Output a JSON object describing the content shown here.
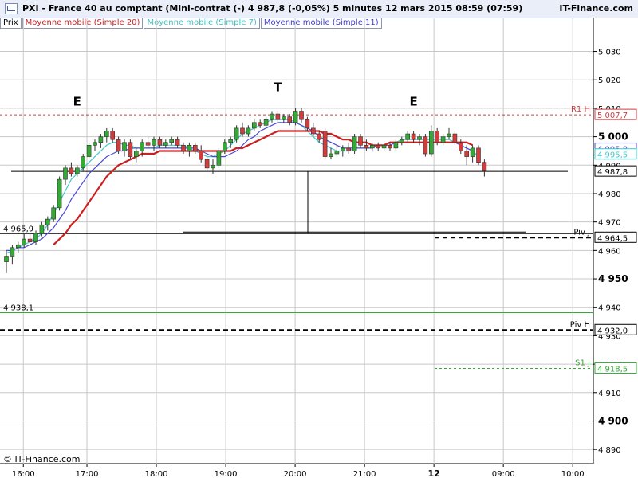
{
  "header": {
    "title": "PXI - France 40 au comptant (Mini-contrat  (-)    4 987,8 (-0,05%)    5 minutes  12 mars 2015 08:59 (07:59)",
    "brand": "IT-Finance.com"
  },
  "legend": {
    "prix": "Prix",
    "ma20": "Moyenne mobile (Simple 20)",
    "ma7": "Moyenne mobile (Simple 7)",
    "ma11": "Moyenne mobile (Simple 11)"
  },
  "copyright": "© IT-Finance.com",
  "colors": {
    "up": "#33aa33",
    "down": "#d23c3c",
    "ma20": "#cc2020",
    "ma7": "#40c8c8",
    "ma11": "#4a4ad8",
    "r1": "#d23c3c",
    "s1": "#33aa33",
    "grid": "#c8c8c8"
  },
  "chart_data": {
    "type": "candlestick",
    "ylim": [
      4885,
      5038
    ],
    "x_ticks": [
      "16:00",
      "17:00",
      "18:00",
      "19:00",
      "20:00",
      "21:00",
      "12",
      "09:00",
      "10:00"
    ],
    "y_ticks": [
      4890,
      4900,
      4910,
      4920,
      4930,
      4940,
      4950,
      4960,
      4970,
      4980,
      4990,
      5000,
      5010,
      5020,
      5030
    ],
    "y_tick_labels": [
      "4 890",
      "4 900",
      "4 910",
      "4 920",
      "4 930",
      "4 940",
      "4 950",
      "4 960",
      "4 970",
      "4 980",
      "4 990",
      "5 000",
      "5 010",
      "5 020",
      "5 030"
    ],
    "bold_ticks": [
      4900,
      4950,
      5000
    ],
    "candles": [
      {
        "o": 4956,
        "h": 4960,
        "l": 4952,
        "c": 4958
      },
      {
        "o": 4958,
        "h": 4962,
        "l": 4955,
        "c": 4961
      },
      {
        "o": 4961,
        "h": 4963,
        "l": 4959,
        "c": 4962
      },
      {
        "o": 4962,
        "h": 4966,
        "l": 4961,
        "c": 4964
      },
      {
        "o": 4964,
        "h": 4966,
        "l": 4962,
        "c": 4963
      },
      {
        "o": 4963,
        "h": 4967,
        "l": 4962,
        "c": 4966
      },
      {
        "o": 4966,
        "h": 4970,
        "l": 4965,
        "c": 4969
      },
      {
        "o": 4969,
        "h": 4972,
        "l": 4967,
        "c": 4971
      },
      {
        "o": 4971,
        "h": 4976,
        "l": 4970,
        "c": 4975
      },
      {
        "o": 4975,
        "h": 4986,
        "l": 4974,
        "c": 4985
      },
      {
        "o": 4985,
        "h": 4990,
        "l": 4983,
        "c": 4989
      },
      {
        "o": 4989,
        "h": 4991,
        "l": 4986,
        "c": 4987
      },
      {
        "o": 4987,
        "h": 4990,
        "l": 4986,
        "c": 4989
      },
      {
        "o": 4989,
        "h": 4994,
        "l": 4988,
        "c": 4993
      },
      {
        "o": 4993,
        "h": 4998,
        "l": 4992,
        "c": 4997
      },
      {
        "o": 4997,
        "h": 4999,
        "l": 4995,
        "c": 4998
      },
      {
        "o": 4998,
        "h": 5001,
        "l": 4996,
        "c": 5000
      },
      {
        "o": 5000,
        "h": 5003,
        "l": 4998,
        "c": 5002
      },
      {
        "o": 5002,
        "h": 5003,
        "l": 4998,
        "c": 4999
      },
      {
        "o": 4999,
        "h": 5000,
        "l": 4994,
        "c": 4995
      },
      {
        "o": 4995,
        "h": 4999,
        "l": 4993,
        "c": 4998
      },
      {
        "o": 4998,
        "h": 4999,
        "l": 4992,
        "c": 4993
      },
      {
        "o": 4993,
        "h": 4996,
        "l": 4991,
        "c": 4995
      },
      {
        "o": 4995,
        "h": 4999,
        "l": 4993,
        "c": 4998
      },
      {
        "o": 4998,
        "h": 5000,
        "l": 4996,
        "c": 4997
      },
      {
        "o": 4997,
        "h": 5000,
        "l": 4995,
        "c": 4999
      },
      {
        "o": 4999,
        "h": 5000,
        "l": 4996,
        "c": 4997
      },
      {
        "o": 4997,
        "h": 4999,
        "l": 4996,
        "c": 4998
      },
      {
        "o": 4998,
        "h": 5000,
        "l": 4997,
        "c": 4999
      },
      {
        "o": 4999,
        "h": 5000,
        "l": 4996,
        "c": 4997
      },
      {
        "o": 4997,
        "h": 4998,
        "l": 4994,
        "c": 4995
      },
      {
        "o": 4995,
        "h": 4998,
        "l": 4993,
        "c": 4997
      },
      {
        "o": 4997,
        "h": 4998,
        "l": 4994,
        "c": 4995
      },
      {
        "o": 4995,
        "h": 4997,
        "l": 4991,
        "c": 4992
      },
      {
        "o": 4992,
        "h": 4993,
        "l": 4988,
        "c": 4989
      },
      {
        "o": 4989,
        "h": 4992,
        "l": 4987,
        "c": 4990
      },
      {
        "o": 4990,
        "h": 4996,
        "l": 4989,
        "c": 4995
      },
      {
        "o": 4995,
        "h": 4999,
        "l": 4994,
        "c": 4998
      },
      {
        "o": 4998,
        "h": 5000,
        "l": 4996,
        "c": 4999
      },
      {
        "o": 4999,
        "h": 5004,
        "l": 4998,
        "c": 5003
      },
      {
        "o": 5003,
        "h": 5005,
        "l": 5000,
        "c": 5001
      },
      {
        "o": 5001,
        "h": 5004,
        "l": 5000,
        "c": 5003
      },
      {
        "o": 5003,
        "h": 5006,
        "l": 5002,
        "c": 5005
      },
      {
        "o": 5005,
        "h": 5006,
        "l": 5003,
        "c": 5004
      },
      {
        "o": 5004,
        "h": 5007,
        "l": 5003,
        "c": 5006
      },
      {
        "o": 5006,
        "h": 5009,
        "l": 5005,
        "c": 5008
      },
      {
        "o": 5008,
        "h": 5009,
        "l": 5005,
        "c": 5006
      },
      {
        "o": 5006,
        "h": 5008,
        "l": 5005,
        "c": 5007
      },
      {
        "o": 5007,
        "h": 5008,
        "l": 5004,
        "c": 5005
      },
      {
        "o": 5005,
        "h": 5010,
        "l": 5004,
        "c": 5009
      },
      {
        "o": 5009,
        "h": 5010,
        "l": 5005,
        "c": 5006
      },
      {
        "o": 5006,
        "h": 5007,
        "l": 5002,
        "c": 5003
      },
      {
        "o": 5003,
        "h": 5005,
        "l": 5000,
        "c": 5001
      },
      {
        "o": 5001,
        "h": 5002,
        "l": 4998,
        "c": 4999
      },
      {
        "o": 5002,
        "h": 5003,
        "l": 4992,
        "c": 4993
      },
      {
        "o": 4993,
        "h": 4996,
        "l": 4992,
        "c": 4994
      },
      {
        "o": 4994,
        "h": 4997,
        "l": 4993,
        "c": 4995
      },
      {
        "o": 4995,
        "h": 4997,
        "l": 4993,
        "c": 4996
      },
      {
        "o": 4996,
        "h": 4998,
        "l": 4994,
        "c": 4995
      },
      {
        "o": 4995,
        "h": 5001,
        "l": 4994,
        "c": 5000
      },
      {
        "o": 5000,
        "h": 5001,
        "l": 4996,
        "c": 4997
      },
      {
        "o": 4997,
        "h": 4999,
        "l": 4995,
        "c": 4996
      },
      {
        "o": 4996,
        "h": 4998,
        "l": 4995,
        "c": 4997
      },
      {
        "o": 4997,
        "h": 4998,
        "l": 4995,
        "c": 4996
      },
      {
        "o": 4996,
        "h": 4998,
        "l": 4995,
        "c": 4997
      },
      {
        "o": 4997,
        "h": 4998,
        "l": 4995,
        "c": 4996
      },
      {
        "o": 4996,
        "h": 4999,
        "l": 4995,
        "c": 4998
      },
      {
        "o": 4998,
        "h": 5000,
        "l": 4997,
        "c": 4999
      },
      {
        "o": 4999,
        "h": 5002,
        "l": 4998,
        "c": 5001
      },
      {
        "o": 5001,
        "h": 5002,
        "l": 4998,
        "c": 4999
      },
      {
        "o": 4999,
        "h": 5001,
        "l": 4997,
        "c": 5000
      },
      {
        "o": 5000,
        "h": 5001,
        "l": 4993,
        "c": 4994
      },
      {
        "o": 4994,
        "h": 5004,
        "l": 4993,
        "c": 5002
      },
      {
        "o": 5002,
        "h": 5003,
        "l": 4997,
        "c": 4998
      },
      {
        "o": 4998,
        "h": 5001,
        "l": 4997,
        "c": 5000
      },
      {
        "o": 5000,
        "h": 5003,
        "l": 4999,
        "c": 5001
      },
      {
        "o": 5001,
        "h": 5002,
        "l": 4997,
        "c": 4998
      },
      {
        "o": 4998,
        "h": 4999,
        "l": 4994,
        "c": 4995
      },
      {
        "o": 4995,
        "h": 4997,
        "l": 4990,
        "c": 4993
      },
      {
        "o": 4993,
        "h": 4997,
        "l": 4991,
        "c": 4996
      },
      {
        "o": 4996,
        "h": 4997,
        "l": 4990,
        "c": 4991
      },
      {
        "o": 4991,
        "h": 4992,
        "l": 4986,
        "c": 4988
      }
    ],
    "ma7": [
      4959,
      4960,
      4961,
      4962,
      4963,
      4964,
      4966,
      4969,
      4973,
      4977,
      4981,
      4985,
      4987,
      4989,
      4991,
      4993,
      4995,
      4997,
      4998,
      4998,
      4997,
      4997,
      4996,
      4996,
      4996,
      4996,
      4997,
      4997,
      4997,
      4997,
      4997,
      4996,
      4995,
      4994,
      4993,
      4993,
      4994,
      4995,
      4997,
      4999,
      5001,
      5002,
      5003,
      5004,
      5005,
      5006,
      5006,
      5006,
      5006,
      5005,
      5004,
      5002,
      5000,
      4998,
      4997,
      4996,
      4995,
      4995,
      4995,
      4996,
      4996,
      4996,
      4996,
      4997,
      4997,
      4998,
      4998,
      4999,
      4999,
      4999,
      4999,
      4999,
      4999,
      4999,
      4999,
      4999,
      4998,
      4997,
      4996,
      4995,
      4993
    ],
    "ma11": [
      4960,
      4960,
      4961,
      4961,
      4962,
      4963,
      4964,
      4966,
      4968,
      4971,
      4974,
      4978,
      4981,
      4984,
      4987,
      4989,
      4991,
      4993,
      4994,
      4995,
      4995,
      4996,
      4996,
      4996,
      4996,
      4996,
      4996,
      4996,
      4996,
      4996,
      4996,
      4996,
      4996,
      4995,
      4994,
      4993,
      4993,
      4993,
      4994,
      4995,
      4997,
      4999,
      5000,
      5002,
      5003,
      5004,
      5005,
      5005,
      5005,
      5005,
      5004,
      5003,
      5002,
      5000,
      4999,
      4998,
      4997,
      4996,
      4996,
      4996,
      4996,
      4996,
      4996,
      4997,
      4997,
      4997,
      4998,
      4998,
      4998,
      4998,
      4998,
      4998,
      4998,
      4998,
      4998,
      4998,
      4998,
      4997,
      4996,
      4995
    ],
    "ma20": [
      null,
      null,
      null,
      null,
      null,
      null,
      null,
      null,
      4962,
      4964,
      4966,
      4969,
      4971,
      4974,
      4977,
      4980,
      4983,
      4986,
      4988,
      4990,
      4991,
      4992,
      4993,
      4994,
      4994,
      4994,
      4995,
      4995,
      4995,
      4995,
      4995,
      4995,
      4995,
      4995,
      4995,
      4995,
      4995,
      4995,
      4995,
      4996,
      4996,
      4997,
      4998,
      4999,
      5000,
      5001,
      5002,
      5002,
      5002,
      5002,
      5002,
      5002,
      5002,
      5002,
      5001,
      5001,
      5000,
      4999,
      4999,
      4998,
      4998,
      4998,
      4997,
      4997,
      4997,
      4998,
      4998,
      4998,
      4998,
      4998,
      4998,
      4998,
      4998,
      4998,
      4998,
      4998,
      4998,
      4998,
      4998,
      4997
    ],
    "levels": [
      {
        "name": "R1 H",
        "value": 5007.7,
        "label": "5 007,7",
        "style": "dashed",
        "color": "#d23c3c"
      },
      {
        "name": "Piv J",
        "value": 4964.5,
        "label": "4 964,5",
        "style": "thickdash",
        "color": "#000000"
      },
      {
        "name": "Piv H",
        "value": 4932.0,
        "label": "4 932,0",
        "style": "thickdash",
        "color": "#000000"
      },
      {
        "name": "S1 J",
        "value": 4918.5,
        "label": "4 918,5",
        "style": "dashed",
        "color": "#33aa33"
      }
    ],
    "price_tags": [
      {
        "value": 4995.8,
        "label": "4 995,8",
        "color": "#4a4ad8"
      },
      {
        "value": 4993.8,
        "label": "4 995,5",
        "color": "#40c8c8"
      },
      {
        "value": 4987.8,
        "label": "4 987,8",
        "color": "#000000"
      }
    ],
    "hlines": [
      {
        "value": 4987.8,
        "label": ""
      },
      {
        "value": 4965.9,
        "label": "4 965,9"
      },
      {
        "value": 4938.1,
        "label": "4 938,1",
        "color": "#33aa33"
      }
    ],
    "annotations": [
      {
        "text": "E",
        "x_index": 12,
        "value": 5011
      },
      {
        "text": "T",
        "x_index": 46,
        "value": 5016
      },
      {
        "text": "E",
        "x_index": 69,
        "value": 5011
      }
    ]
  }
}
